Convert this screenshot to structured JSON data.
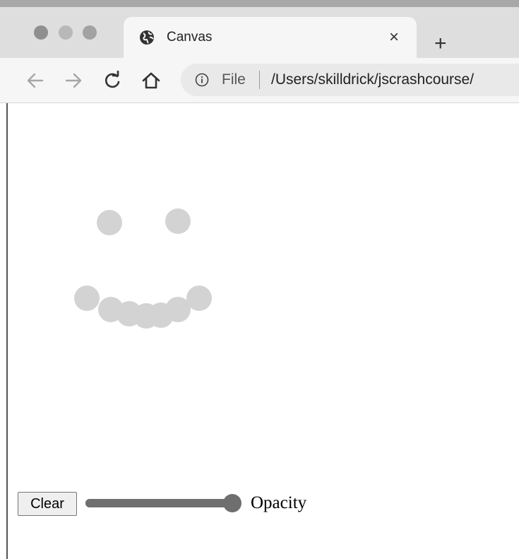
{
  "browser": {
    "tab": {
      "title": "Canvas",
      "close_glyph": "×",
      "icon": "globe-icon"
    },
    "new_tab_glyph": "+",
    "toolbar": {
      "back_icon": "back-arrow-icon",
      "forward_icon": "forward-arrow-icon",
      "reload_icon": "reload-icon",
      "home_icon": "home-icon"
    },
    "address_bar": {
      "info_icon": "info-icon",
      "scheme": "File",
      "url": "/Users/skilldrick/jscrashcourse/"
    }
  },
  "page": {
    "clear_label": "Clear",
    "slider": {
      "label": "Opacity",
      "value_fraction": 1.0
    }
  },
  "colors": {
    "dot": "#d3d3d3",
    "slider": "#6f6f6f",
    "chrome_bg": "#dedede",
    "tab_bg": "#f6f6f6"
  },
  "drawing": {
    "shape": "smiley face of circles",
    "dot_count": 9
  }
}
